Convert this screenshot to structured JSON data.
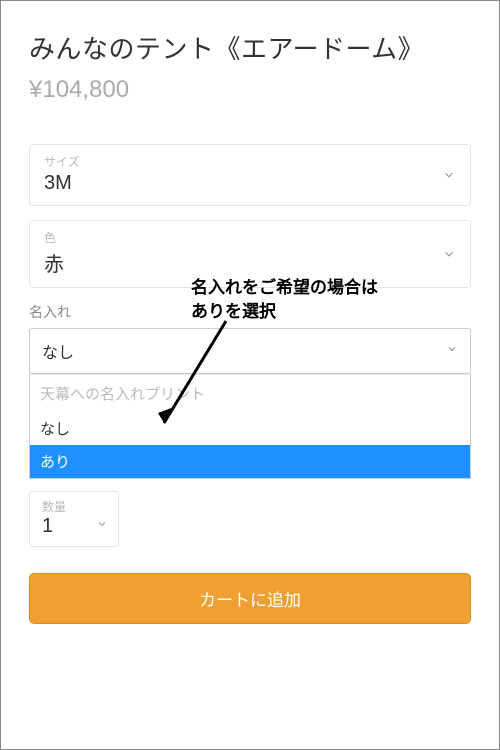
{
  "title": "みんなのテント《エアードーム》",
  "price": "¥104,800",
  "size": {
    "label": "サイズ",
    "value": "3M"
  },
  "color": {
    "label": "色",
    "value": "赤"
  },
  "naming": {
    "label": "名入れ",
    "selected": "なし",
    "dropdown_header": "天幕への名入れプリント",
    "options": [
      "なし",
      "あり"
    ],
    "highlighted": "あり"
  },
  "quantity": {
    "label": "数量",
    "value": "1"
  },
  "add_to_cart": "カートに追加",
  "annotation": {
    "line1": "名入れをご希望の場合は",
    "line2": "ありを選択"
  }
}
